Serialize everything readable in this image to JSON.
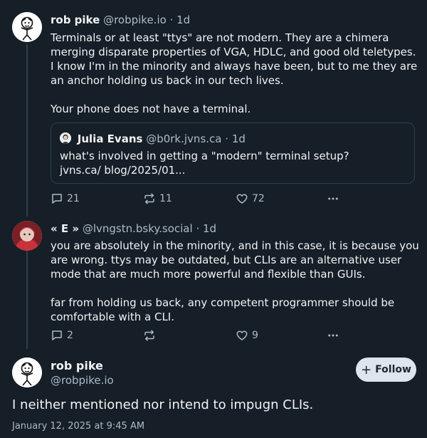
{
  "posts": [
    {
      "author": "rob pike",
      "handle": "@robpike.io",
      "sep": "·",
      "time": "1d",
      "paragraphs": [
        "Terminals or at least \"ttys\" are not modern. They are a chimera merging disparate properties of VGA, HDLC, and good old teletypes. I know I'm in the minority and always have been, but to me they are an anchor holding us back in our tech lives.",
        "Your phone does not have a terminal."
      ],
      "quote": {
        "author": "Julia Evans",
        "handle": "@b0rk.jvns.ca",
        "sep": "·",
        "time": "1d",
        "text": "what's involved in getting a \"modern\" terminal setup? jvns.ca/ blog/2025/01..."
      },
      "replies": "21",
      "reposts": "11",
      "likes": "72"
    },
    {
      "author": "« E »",
      "handle": "@lvngstn.bsky.social",
      "sep": "·",
      "time": "1d",
      "paragraphs": [
        "you are absolutely in the minority, and in this case, it is because you are wrong. ttys may be outdated, but CLIs are an alternative user mode that are much more powerful and flexible than GUIs.",
        "far from holding us back, any competent programmer should be comfortable with a CLI."
      ],
      "replies": "2",
      "reposts": "",
      "likes": "9"
    }
  ],
  "focus": {
    "author": "rob pike",
    "handle": "@robpike.io",
    "follow_label": "Follow",
    "text": "I neither mentioned nor intend to impugn CLIs.",
    "date": "January 12, 2025 at 9:45 AM"
  },
  "icons": {
    "reply": "reply-icon",
    "repost": "repost-icon",
    "like": "heart-icon",
    "more": "more-icon"
  },
  "colors": {
    "background": "#161e27",
    "text": "#f1f3f5",
    "muted": "#aebbc9",
    "border": "#2e4052",
    "follow_bg": "#dfe5ec"
  }
}
